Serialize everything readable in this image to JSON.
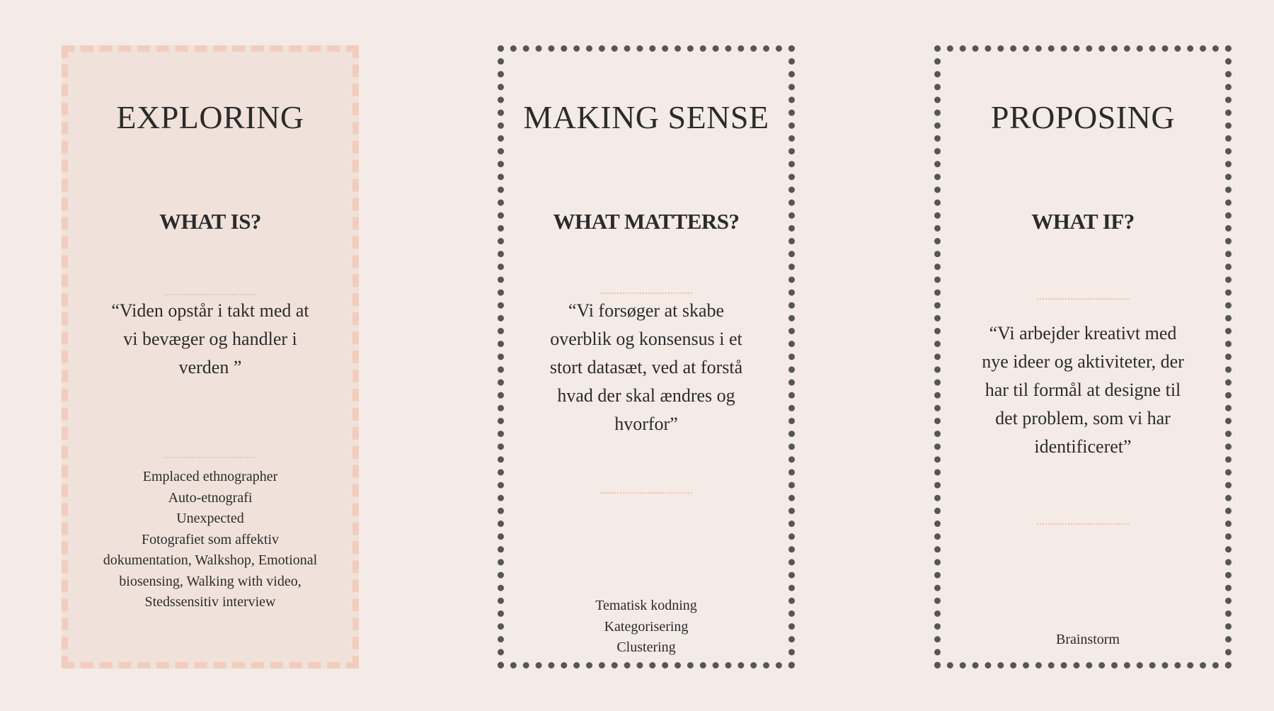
{
  "columns": [
    {
      "title": "EXPLORING",
      "subtitle": "WHAT IS?",
      "quote": "“Viden opstår i takt med at vi bevæger og handler i verden ”",
      "methods": [
        "Emplaced ethnographer",
        "Auto-etnografi",
        "Unexpected",
        "Fotografiet som affektiv dokumentation, Walkshop, Emotional biosensing, Walking with video, Stedssensitiv interview"
      ]
    },
    {
      "title": "MAKING SENSE",
      "subtitle": "WHAT MATTERS?",
      "quote": "“Vi forsøger at skabe overblik og konsensus i et stort datasæt, ved at forstå hvad der skal ændres og hvorfor”",
      "methods": [
        "Tematisk kodning",
        "Kategorisering",
        "Clustering"
      ]
    },
    {
      "title": "PROPOSING",
      "subtitle": "WHAT IF?",
      "quote": "“Vi arbejder kreativt med nye ideer og aktiviteter, der har til formål at designe til det problem, som vi har identificeret”",
      "methods": [
        "Brainstorm"
      ]
    }
  ]
}
